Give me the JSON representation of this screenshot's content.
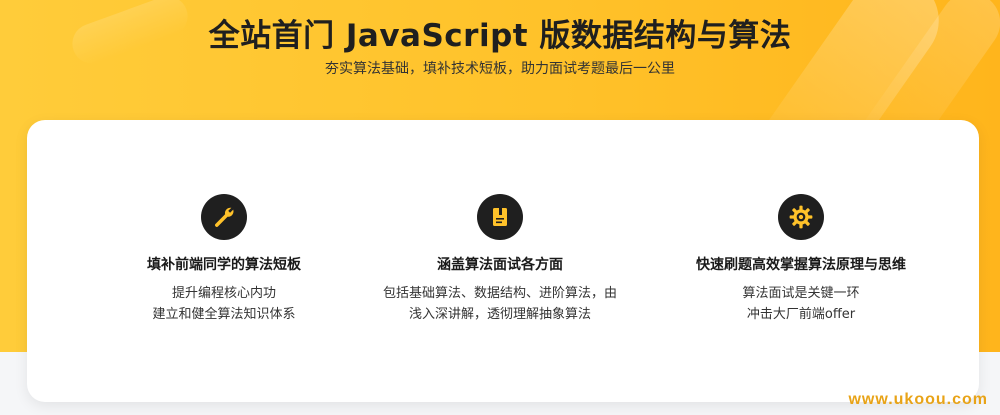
{
  "header": {
    "title": "全站首门 JavaScript 版数据结构与算法",
    "subtitle": "夯实算法基础，填补技术短板，助力面试考题最后一公里"
  },
  "features": [
    {
      "icon": "wrench-icon",
      "title": "填补前端同学的算法短板",
      "desc_line1": "提升编程核心内功",
      "desc_line2": "建立和健全算法知识体系"
    },
    {
      "icon": "book-icon",
      "title": "涵盖算法面试各方面",
      "desc_line1": "包括基础算法、数据结构、进阶算法，由",
      "desc_line2": "浅入深讲解，透彻理解抽象算法"
    },
    {
      "icon": "gear-icon",
      "title": "快速刷题高效掌握算法原理与思维",
      "desc_line1": "算法面试是关键一环",
      "desc_line2": "冲击大厂前端offer"
    }
  ],
  "watermark": "www.ukoou.com",
  "colors": {
    "hero_yellow": "#ffc22a",
    "icon_bg": "#1f1f1f",
    "icon_fg": "#ffc22a",
    "watermark": "#e8a317"
  }
}
